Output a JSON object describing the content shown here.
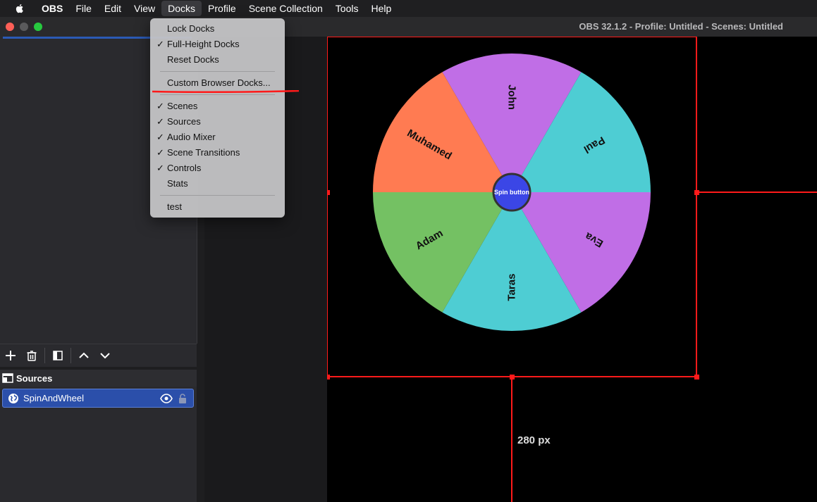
{
  "menubar": {
    "app_name": "OBS",
    "items": [
      "File",
      "Edit",
      "View",
      "Docks",
      "Profile",
      "Scene Collection",
      "Tools",
      "Help"
    ],
    "active": "Docks"
  },
  "window": {
    "title": "OBS 32.1.2 - Profile: Untitled - Scenes: Untitled"
  },
  "docks_menu": {
    "items": [
      {
        "label": "Lock Docks",
        "checked": false
      },
      {
        "label": "Full-Height Docks",
        "checked": true
      },
      {
        "label": "Reset Docks",
        "checked": false
      },
      {
        "label": "Custom Browser Docks...",
        "checked": false
      },
      {
        "label": "Scenes",
        "checked": true
      },
      {
        "label": "Sources",
        "checked": true
      },
      {
        "label": "Audio Mixer",
        "checked": true
      },
      {
        "label": "Scene Transitions",
        "checked": true
      },
      {
        "label": "Controls",
        "checked": true
      },
      {
        "label": "Stats",
        "checked": false
      },
      {
        "label": "test",
        "checked": false
      }
    ],
    "check_glyph": "✓"
  },
  "sources": {
    "title": "Sources",
    "items": [
      {
        "name": "SpinAndWheel",
        "visible": true,
        "locked": false
      }
    ]
  },
  "wheel": {
    "segments": [
      {
        "label": "John",
        "color": "#c06ee6"
      },
      {
        "label": "Paul",
        "color": "#4ecdd3"
      },
      {
        "label": "Eva",
        "color": "#c06ee6"
      },
      {
        "label": "Taras",
        "color": "#4ecdd3"
      },
      {
        "label": "Adam",
        "color": "#74c163"
      },
      {
        "label": "Muhamed",
        "color": "#ff7b52"
      }
    ],
    "button_label": "Spin button",
    "button_color": "#3b46e6"
  },
  "measure": {
    "label": "280 px"
  },
  "colors": {
    "selection_red": "#ff1a1a",
    "source_selected": "#2b4faa"
  }
}
